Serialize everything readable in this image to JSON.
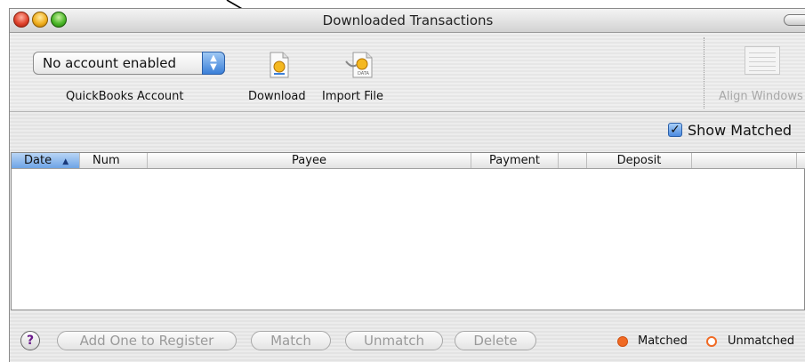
{
  "window": {
    "title": "Downloaded Transactions"
  },
  "toolbar": {
    "account_popup_value": "No account enabled",
    "account_label": "QuickBooks Account",
    "download_label": "Download",
    "import_label": "Import File",
    "import_icon_text": "DATA",
    "align_label": "Align Windows"
  },
  "filter": {
    "show_matched_label": "Show Matched",
    "show_matched_checked": true
  },
  "table": {
    "columns": [
      "Date",
      "Num",
      "Payee",
      "Payment",
      "Deposit"
    ],
    "sort_indicator": "▲",
    "rows": []
  },
  "footer": {
    "help_label": "?",
    "add_button": "Add One to Register",
    "match_button": "Match",
    "unmatch_button": "Unmatch",
    "delete_button": "Delete",
    "legend_matched": "Matched",
    "legend_unmatched": "Unmatched"
  },
  "colors": {
    "matched": "#f06a24",
    "accent": "#3b7fd8"
  }
}
